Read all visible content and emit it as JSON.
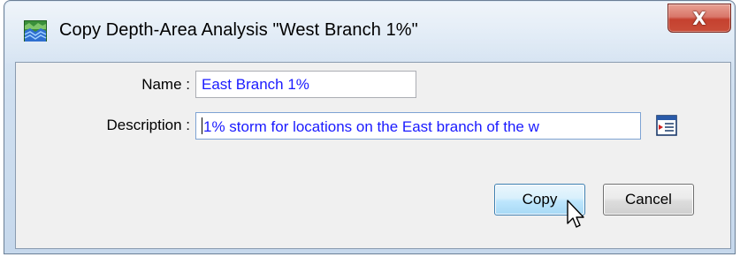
{
  "window": {
    "title": "Copy Depth-Area Analysis \"West Branch 1%\"",
    "icon": "depth-area-analysis-icon",
    "close_label": "X"
  },
  "form": {
    "name_label": "Name :",
    "name_value": "East Branch 1%",
    "description_label": "Description :",
    "description_value": "1% storm for locations on the East branch of the w",
    "description_browse_icon": "text-editor-icon"
  },
  "buttons": {
    "copy_label": "Copy",
    "cancel_label": "Cancel"
  },
  "colors": {
    "input_text": "#1a1aff",
    "close_button": "#c5412f",
    "default_button": "#a7d9f5"
  }
}
